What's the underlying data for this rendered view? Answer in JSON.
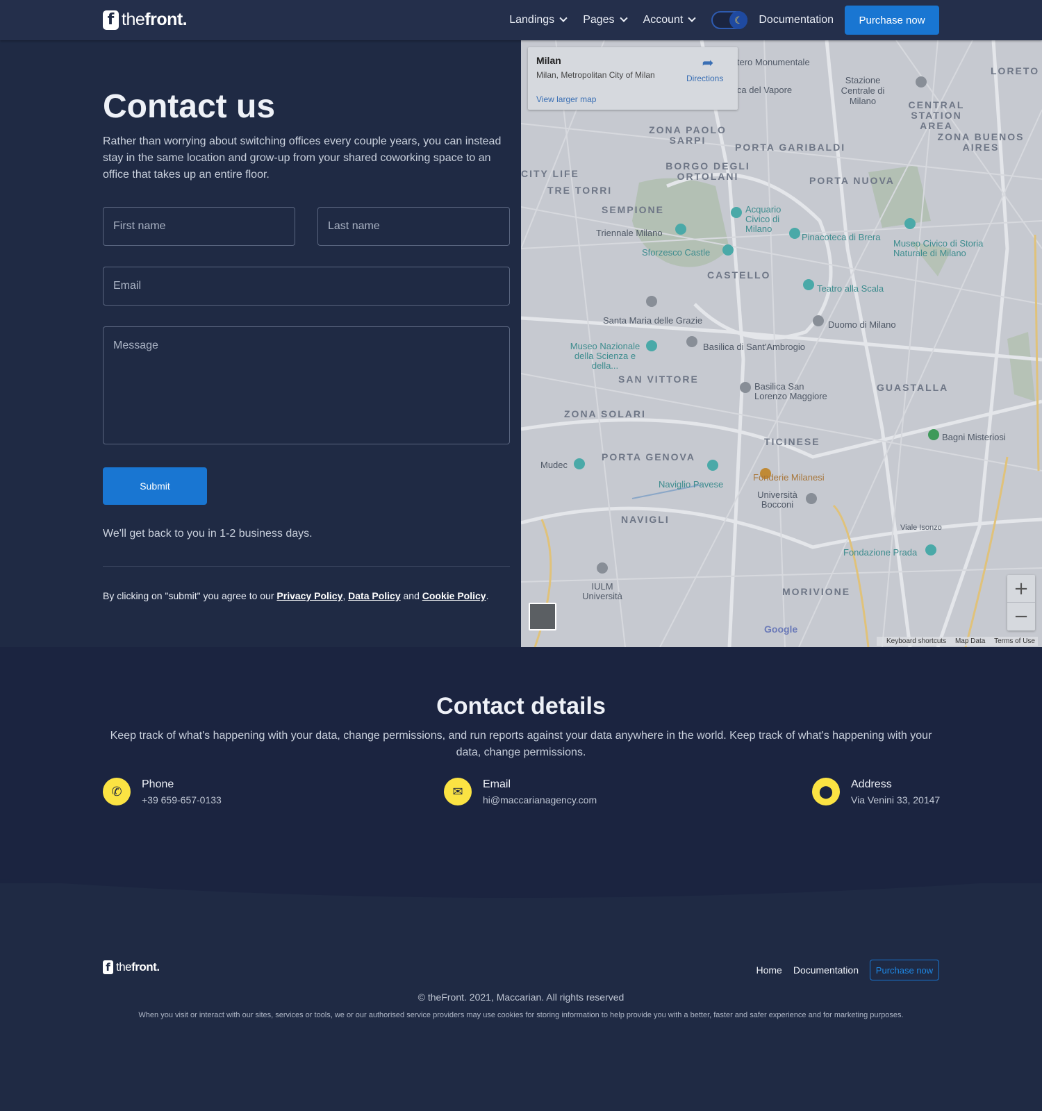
{
  "header": {
    "logo_mark": "f",
    "logo_text_light": "the",
    "logo_text_bold": "front.",
    "nav": [
      {
        "label": "Landings"
      },
      {
        "label": "Pages"
      },
      {
        "label": "Account"
      }
    ],
    "theme_toggle_icon": "☾",
    "documentation": "Documentation",
    "purchase": "Purchase now"
  },
  "contact": {
    "title": "Contact us",
    "lead": "Rather than worrying about switching offices every couple years, you can instead stay in the same location and grow-up from your shared coworking space to an office that takes up an entire floor.",
    "first_name_placeholder": "First name",
    "last_name_placeholder": "Last name",
    "email_placeholder": "Email",
    "message_placeholder": "Message",
    "submit": "Submit",
    "back_note": "We'll get back to you in 1-2 business days.",
    "terms_prefix": "By clicking on \"submit\" you agree to our ",
    "privacy_policy": "Privacy Policy",
    "comma": ", ",
    "data_policy": "Data Policy",
    "and": " and ",
    "cookie_policy": "Cookie Policy",
    "period": "."
  },
  "map": {
    "place_title": "Milan",
    "place_subtitle": "Milan, Metropolitan City of Milan",
    "view_larger": "View larger map",
    "directions": "Directions",
    "zoom_in": "+",
    "zoom_out": "−",
    "google": "Google",
    "keyboard_shortcuts": "Keyboard shortcuts",
    "map_data": "Map Data",
    "terms_of_use": "Terms of Use",
    "labels": {
      "l1": "itero Monumentale",
      "l2": "ica del Vapore",
      "l3": "Stazione Centrale di Milano",
      "l4": "CENTRAL STATION AREA",
      "l5": "ZONA BUENOS AIRES",
      "l6": "ZONA PAOLO SARPI",
      "l7": "PORTA GARIBALDI",
      "l8": "CITY LIFE",
      "l9": "TRE TORRI",
      "l10": "BORGO DEGLI ORTOLANI",
      "l11": "PORTA NUOVA",
      "l12": "SEMPIONE",
      "l13": "Acquario Civico di Milano",
      "l14": "Triennale Milano",
      "l15": "Pinacoteca di Brera",
      "l16": "Museo Civico di Storia Naturale di Milano",
      "l17": "Sforzesco Castle",
      "l18": "CASTELLO",
      "l19": "Teatro alla Scala",
      "l20": "Santa Maria delle Grazie",
      "l21": "Duomo di Milano",
      "l22": "Museo Nazionale della Scienza e della...",
      "l23": "Basilica di Sant'Ambrogio",
      "l24": "SAN VITTORE",
      "l25": "Basilica San Lorenzo Maggiore",
      "l26": "GUASTALLA",
      "l27": "ZONA SOLARI",
      "l28": "TICINESE",
      "l29": "Bagni Misteriosi",
      "l30": "Mudec",
      "l31": "PORTA GENOVA",
      "l32": "Naviglio Pavese",
      "l33": "Fonderie Milanesi",
      "l34": "Università Bocconi",
      "l35": "NAVIGLI",
      "l36": "Viale Isonzo",
      "l37": "Fondazione Prada",
      "l38": "IULM Università",
      "l39": "MORIVIONE",
      "l40": "LORETO"
    }
  },
  "details": {
    "title": "Contact details",
    "lead": "Keep track of what's happening with your data, change permissions, and run reports against your data anywhere in the world. Keep track of what's happening with your data, change permissions.",
    "items": [
      {
        "label": "Phone",
        "value": "+39 659-657-0133",
        "icon": "phone-icon"
      },
      {
        "label": "Email",
        "value": "hi@maccarianagency.com",
        "icon": "mail-icon"
      },
      {
        "label": "Address",
        "value": "Via Venini 33, 20147",
        "icon": "location-pin-icon"
      }
    ]
  },
  "footer": {
    "home": "Home",
    "documentation": "Documentation",
    "purchase": "Purchase now",
    "copyright": "© theFront. 2021, Maccarian. All rights reserved",
    "cookies": "When you visit or interact with our sites, services or tools, we or our authorised service providers may use cookies for storing information to help provide you with a better, faster and safer experience and for marketing purposes."
  },
  "colors": {
    "background": "#1f2a44",
    "header": "#242f4b",
    "primary": "#1976d2",
    "accent_yellow": "#fbe343",
    "details_bg": "#1b2440"
  }
}
